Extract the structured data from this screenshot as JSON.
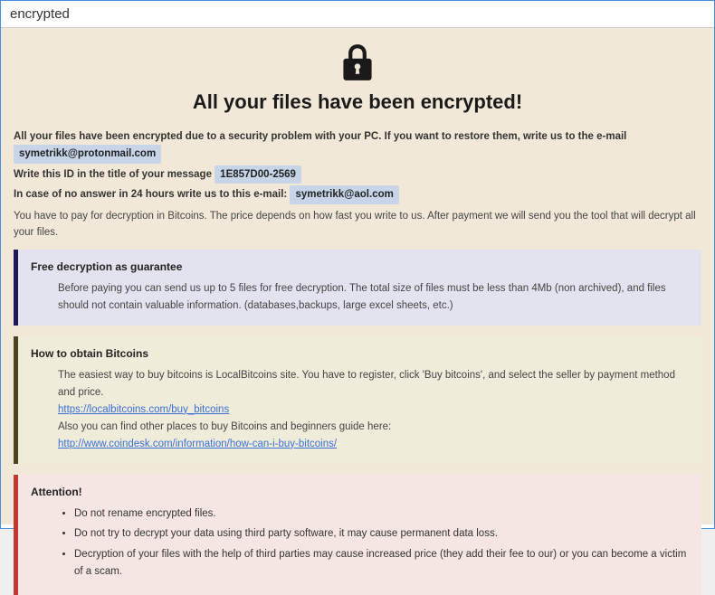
{
  "window": {
    "title": "encrypted"
  },
  "header": {
    "title": "All your files have been encrypted!"
  },
  "intro": {
    "line1_prefix": "All your files have been encrypted due to a security problem with your PC. If you want to restore them, write us to the e-mail",
    "email1": "symetrikk@protonmail.com",
    "line2_prefix": "Write this ID in the title of your message",
    "id_value": "1E857D00-2569",
    "line3_prefix": "In case of no answer in 24 hours write us to this e-mail:",
    "email2": "symetrikk@aol.com",
    "payment_line": "You have to pay for decryption in Bitcoins. The price depends on how fast you write to us. After payment we will send you the tool that will decrypt all your files."
  },
  "box1": {
    "title": "Free decryption as guarantee",
    "body": "Before paying you can send us up to 5 files for free decryption. The total size of files must be less than 4Mb (non archived), and files should not contain valuable information. (databases,backups, large excel sheets, etc.)"
  },
  "box2": {
    "title": "How to obtain Bitcoins",
    "line1": "The easiest way to buy bitcoins is LocalBitcoins site. You have to register, click 'Buy bitcoins', and select the seller by payment method and price.",
    "link1": "https://localbitcoins.com/buy_bitcoins",
    "line2": "Also you can find other places to buy Bitcoins and beginners guide here:",
    "link2": "http://www.coindesk.com/information/how-can-i-buy-bitcoins/"
  },
  "box3": {
    "title": "Attention!",
    "items": [
      "Do not rename encrypted files.",
      "Do not try to decrypt your data using third party software, it may cause permanent data loss.",
      "Decryption of your files with the help of third parties may cause increased price (they add their fee to our) or you can become a victim of a scam."
    ]
  }
}
